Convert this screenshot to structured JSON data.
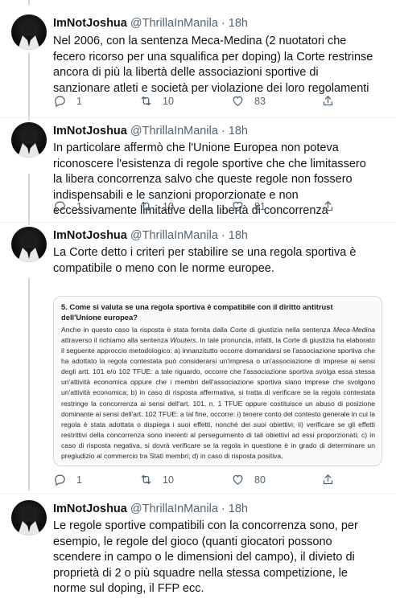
{
  "tweets": [
    {
      "name": "ImNotJoshua",
      "handle": "@ThrillaInManila · 18h",
      "text": "Nel 2006, con la sentenza Meca-Medina (2 nuotatori che fecero ricorso per una squalifica per doping) la Corte restrinse ancora di più la libertà delle associazioni sportive di sanzionare atleti e società per violazione dei loro regolamenti",
      "replies": "1",
      "retweets": "10",
      "likes": "83"
    },
    {
      "name": "ImNotJoshua",
      "handle": "@ThrillaInManila · 18h",
      "text": "In particolare affermò che l'Unione Europea non poteva riconoscere l'esistenza di regole sportive che che limitassero la libera concorrenza salvo che queste regole non fossero indispensabili e le sanzioni proporzionate e non eccessivamente limitative della libertà di concorrenza",
      "replies": "1",
      "retweets": "10",
      "likes": "81"
    },
    {
      "name": "ImNotJoshua",
      "handle": "@ThrillaInManila · 18h",
      "text": "La Corte detto i criteri per stabilire se una regola sportiva è compatibile o meno con le norme europee.",
      "replies": "1",
      "retweets": "10",
      "likes": "80"
    },
    {
      "name": "ImNotJoshua",
      "handle": "@ThrillaInManila · 18h",
      "text": "Le regole sportive compatibili con la concorrenza sono, per esempio, le regole del gioco (quanti giocatori possono scendere in campo o le dimensioni del campo), il divieto di proprietà di 2 o più squadre nella stessa competizione, le norme sul doping, il FFP ecc."
    }
  ],
  "document_image": {
    "title": "5. Come si valuta se una regola sportiva è compatibile con il diritto antitrust dell'Unione europea?",
    "paragraph_start": "Anche in questo caso la risposta è stata fornita dalla Corte di giustizia nella sentenza ",
    "paragraph_em1": "Meca-Medina",
    "paragraph_mid1": " attraverso il richiamo alla sentenza ",
    "paragraph_em2": "Wouters",
    "paragraph_rest": ". In tale pronuncia, infatti, la Corte di giustizia ha elaborato il seguente approccio metodologico: a) innanzitutto occorre domandarsi se l'associazione sportiva che ha adottato la regola contestata può considerarsi un'impresa o un'associazione di imprese ai sensi degli artt. 101 e/o 102 TFUE: a tale riguardo, occorre che l'associazione sportiva svolga essa stessa un'attività economica oppure che i membri dell'associazione sportiva siano imprese che svolgono un'attività economica; b) in caso di risposta affermativa, si tratta di verificare se la regola contestata restringe la concorrenza ai sensi dell'art. 101, n. 1 TFUE oppure costituisce un abuso di posizione dominante ai sensi dell'art. 102 TFUE: a tal fine, occorre: i) tenere conto del contesto generale in cui la regola è stata adottata o dispiega i suoi effetti, nonché dei suoi obiettivi; ii) verificare se gli effetti restrittivi della concorrenza sono inerenti al perseguimento di tali obiettivi ad essi proporzionati; c) in caso di risposta negativa, si dovrà verificare se la regola in questione è in grado di determinare un pregiudizio  al commercio tra Stati membri; d) in caso di risposta positiva,"
  },
  "icons": {
    "reply": "reply-icon",
    "retweet": "retweet-icon",
    "like": "heart-icon",
    "share": "share-icon"
  },
  "colors": {
    "text": "#0f1419",
    "secondary": "#536471",
    "thread_line": "#cfd9de"
  }
}
